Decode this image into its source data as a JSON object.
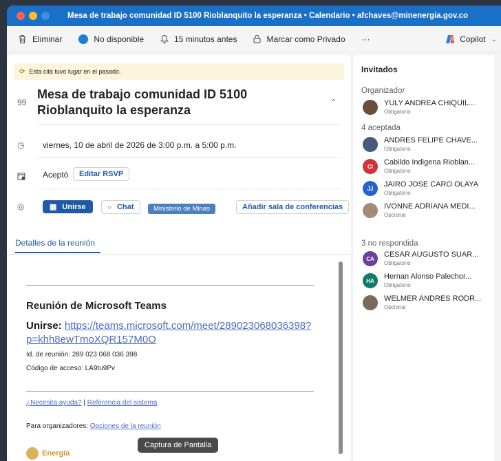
{
  "window": {
    "title": "Mesa de trabajo comunidad  ID 5100 Rioblanquito la esperanza • Calendario • afchaves@minenergia.gov.co",
    "traffic_colors": [
      "#ff5f57",
      "#febc2e",
      "#3a8ee6"
    ]
  },
  "toolbar": {
    "delete": "Eliminar",
    "status": "No disponible",
    "reminder": "15 minutos antes",
    "private": "Marcar como Privado",
    "more": "···",
    "copilot": "Copilot"
  },
  "event": {
    "past_notice": "Esta cita tuvo lugar en el pasado.",
    "subject": "Mesa de trabajo comunidad  ID 5100 Rioblanquito la esperanza",
    "datetime": "viernes, 10 de abril de 2026 de 3:00 p.m. a 5:00 p.m.",
    "response": "Aceptó",
    "edit_rsvp": "Editar RSVP",
    "join": "Unirse",
    "chat": "Chat",
    "org_tag": "Ministerio de Minas",
    "add_room": "Añadir sala de conferencias",
    "tab_details": "Detalles de la reunión"
  },
  "details": {
    "teams_title": "Reunión de Microsoft Teams",
    "join_label": "Unirse:",
    "join_url_1": "https://teams.microsoft.com/meet/289023068036398?",
    "join_url_2": "p=khh8ewTmoXQR157M0O",
    "meeting_id_label": "Id. de reunión:",
    "meeting_id": "289 023 068 036 398",
    "passcode_label": "Código de acceso:",
    "passcode": "LA9tu9Pv",
    "help_link": "¿Necesita ayuda?",
    "separator": "|",
    "system_ref": "Referencia del sistema",
    "organizers_label": "Para organizadores:",
    "options_link": "Opciones de la reunión",
    "energy_logo_text": "Energía",
    "tooltip": "Captura de Pantalla"
  },
  "attendees": {
    "title": "Invitados",
    "organizer_header": "Organizador",
    "accepted_header": "4 aceptada",
    "noresponse_header": "3 no respondida",
    "organizer": [
      {
        "name": "YULY ANDREA CHIQUIL...",
        "role": "Obligatorio",
        "initials": "",
        "color": "#6b4f3a"
      }
    ],
    "accepted": [
      {
        "name": "ANDRES FELIPE CHAVE...",
        "role": "Obligatorio",
        "initials": "",
        "color": "#4a5a7a"
      },
      {
        "name": "Cabildo Indigena Rioblan...",
        "role": "Obligatorio",
        "initials": "CI",
        "color": "#d13438"
      },
      {
        "name": "JAIRO JOSE CARO OLAYA",
        "role": "Obligatorio",
        "initials": "JJ",
        "color": "#2564cf"
      },
      {
        "name": "IVONNE ADRIANA MEDI...",
        "role": "Opcional",
        "initials": "",
        "color": "#a58a78"
      }
    ],
    "noresponse": [
      {
        "name": "CESAR AUGUSTO SUAR...",
        "role": "Obligatorio",
        "initials": "CA",
        "color": "#6b3fa0"
      },
      {
        "name": "Hernan Alonso Palechor...",
        "role": "Obligatorio",
        "initials": "HA",
        "color": "#0f7b6c"
      },
      {
        "name": "WELMER ANDRES RODR...",
        "role": "Opcional",
        "initials": "",
        "color": "#7a6a5a"
      }
    ]
  }
}
